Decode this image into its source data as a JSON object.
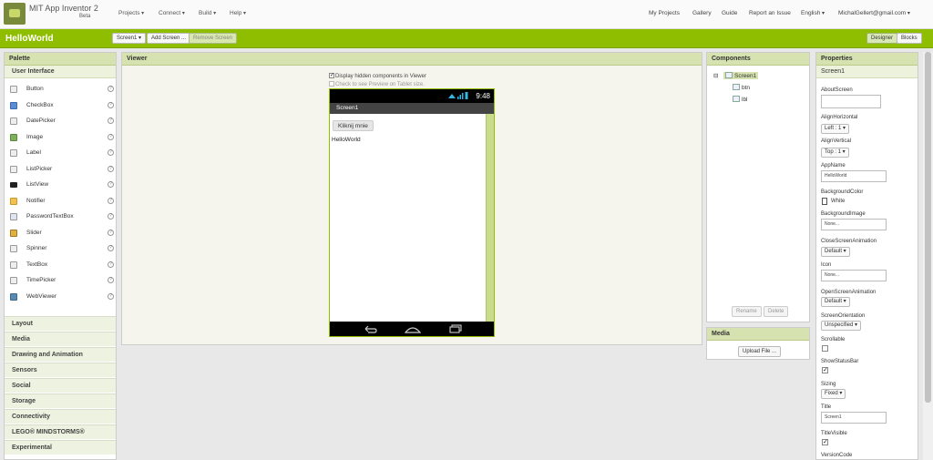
{
  "app": {
    "name": "MIT App Inventor 2",
    "edition": "Beta"
  },
  "top_menu": [
    "Projects",
    "Connect",
    "Build",
    "Help"
  ],
  "top_links": [
    "My Projects",
    "Gallery",
    "Guide",
    "Report an Issue"
  ],
  "language": "English",
  "user": "MichalGellert@gmail.com",
  "toolbar": {
    "project_name": "HelloWorld",
    "screen_select": "Screen1",
    "add_screen": "Add Screen ...",
    "remove_screen": "Remove Screen",
    "designer": "Designer",
    "blocks": "Blocks"
  },
  "palette": {
    "title": "Palette",
    "open_category": "User Interface",
    "items": [
      "Button",
      "CheckBox",
      "DatePicker",
      "Image",
      "Label",
      "ListPicker",
      "ListView",
      "Notifier",
      "PasswordTextBox",
      "Slider",
      "Spinner",
      "TextBox",
      "TimePicker",
      "WebViewer"
    ],
    "help_glyph": "?",
    "categories": [
      "Layout",
      "Media",
      "Drawing and Animation",
      "Sensors",
      "Social",
      "Storage",
      "Connectivity",
      "LEGO® MINDSTORMS®",
      "Experimental"
    ]
  },
  "viewer": {
    "title": "Viewer",
    "display_hidden": "Display hidden components in Viewer",
    "tablet_preview": "Check to see Preview on Tablet size.",
    "phone": {
      "time": "9:48",
      "screen_title": "Screen1",
      "button_text": "Kliknij mnie",
      "label_text": "HelloWorld"
    }
  },
  "components": {
    "title": "Components",
    "tree": [
      "Screen1",
      "btn",
      "lbl"
    ],
    "rename": "Rename",
    "delete": "Delete"
  },
  "media": {
    "title": "Media",
    "upload": "Upload File ..."
  },
  "properties": {
    "title": "Properties",
    "component": "Screen1",
    "about_screen": {
      "label": "AboutScreen",
      "value": ""
    },
    "align_horizontal": {
      "label": "AlignHorizontal",
      "value": "Left : 1"
    },
    "align_vertical": {
      "label": "AlignVertical",
      "value": "Top : 1"
    },
    "app_name": {
      "label": "AppName",
      "value": "HelloWorld"
    },
    "background_color": {
      "label": "BackgroundColor",
      "value": "White"
    },
    "background_image": {
      "label": "BackgroundImage",
      "value": "None..."
    },
    "close_screen_animation": {
      "label": "CloseScreenAnimation",
      "value": "Default"
    },
    "icon": {
      "label": "Icon",
      "value": "None..."
    },
    "open_screen_animation": {
      "label": "OpenScreenAnimation",
      "value": "Default"
    },
    "screen_orientation": {
      "label": "ScreenOrientation",
      "value": "Unspecified"
    },
    "scrollable": {
      "label": "Scrollable",
      "checked": false
    },
    "show_status_bar": {
      "label": "ShowStatusBar",
      "checked": true
    },
    "sizing": {
      "label": "Sizing",
      "value": "Fixed"
    },
    "title_prop": {
      "label": "Title",
      "value": "Screen1"
    },
    "title_visible": {
      "label": "TitleVisible",
      "checked": true
    },
    "version_code": {
      "label": "VersionCode"
    }
  },
  "colors": {
    "toolbar_green": "#8fbe00",
    "panel_header": "#d6e3b0",
    "phone_border": "#8fbe00"
  }
}
